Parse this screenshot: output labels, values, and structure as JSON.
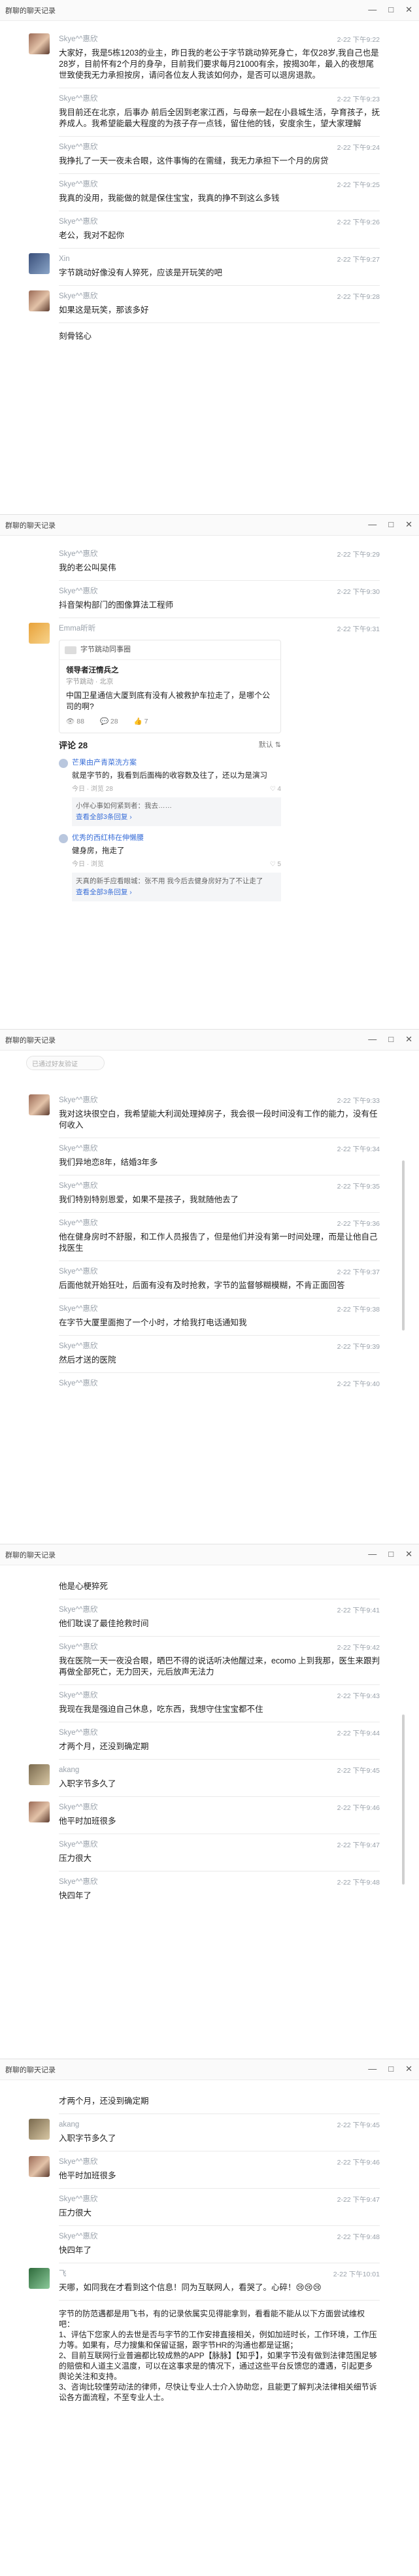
{
  "window": {
    "title": "群聊的聊天记录",
    "controls": [
      "—",
      "□",
      "✕"
    ]
  },
  "pages": [
    {
      "messages": [
        {
          "avatar": "girl",
          "name": "Skye^^惠欣",
          "time": "2-22 下午9:22",
          "text": "大家好，我是5栋1203的业主，昨日我的老公于字节跳动猝死身亡，年仅28岁,我自己也是28岁，目前怀有2个月的身孕，目前我们要求每月21000有余，按揭30年，最入的夜想尾世致使我无力承担按房，请问各位友人我该如何办，是否可以退房退款。"
        },
        {
          "avatar": "girl",
          "name": "Skye^^惠欣",
          "time": "2-22 下午9:23",
          "text": "我目前还在北京，后事办 前后全因到老家江西，与母亲一起在小县城生活，孕育孩子，抚养成人。我希望能最大程度的为孩子存一点钱，留住他的钱，安度余生，望大家理解"
        },
        {
          "avatar": "girl",
          "name": "Skye^^惠欣",
          "time": "2-22 下午9:24",
          "text": "我挣扎了一天一夜未合眼，这件事悔的在需缝，我无力承担下一个月的房贷"
        },
        {
          "avatar": "girl",
          "name": "Skye^^惠欣",
          "time": "2-22 下午9:25",
          "text": "我真的没用，我能做的就是保住宝宝，我真的挣不到这么多钱"
        },
        {
          "avatar": "girl",
          "name": "Skye^^惠欣",
          "time": "2-22 下午9:26",
          "text": "老公，我对不起你"
        },
        {
          "avatar": "xin",
          "name": "Xin",
          "time": "2-22 下午9:27",
          "text": "字节跳动好像没有人猝死，应该是开玩笑的吧"
        },
        {
          "avatar": "girl",
          "name": "Skye^^惠欣",
          "time": "2-22 下午9:28",
          "text": "如果这是玩笑，那该多好"
        },
        {
          "avatar": "girl",
          "name": "",
          "time": "",
          "text": "刻骨铭心"
        }
      ]
    },
    {
      "messages": [
        {
          "avatar": "girl",
          "name": "Skye^^惠欣",
          "time": "2-22 下午9:29",
          "text": "我的老公叫吴伟"
        },
        {
          "avatar": "girl",
          "name": "Skye^^惠欣",
          "time": "2-22 下午9:30",
          "text": "抖音架构部门的图像算法工程师"
        }
      ],
      "forward": {
        "name": "Emma昕昕",
        "time": "2-22 下午9:31",
        "card_head": "字节跳动同事圈",
        "post_author": "领导者汪情兵之",
        "post_sub": "字节跳动 · 北京",
        "post_text": "中国卫星通信大厦到底有没有人被救护车拉走了，是哪个公司的啊?",
        "post_stats": [
          "👁 88",
          "💬 28",
          "👍 7"
        ],
        "comments_title": "评论 28",
        "comments_sort": "默认 ⇅",
        "comments": [
          {
            "who": "芒果由产青菜洗方案",
            "body": "就是字节的，我看到后面梅的收容数及往了，还以为是演习",
            "meta_left": "今日 · 浏览 28",
            "meta_right": "♡ 4",
            "quote": "小伴心事如何紧到者：我去……",
            "quote_more": "查看全部3条回复 ›"
          },
          {
            "who": "优秀的西红柿在伸懒腰",
            "body": "健身房，拖走了",
            "meta_left": "今日 · 浏览",
            "meta_right": "♡ 5",
            "quote": "天真的新手应看眼城：张不用 我今后去健身房好为了不让走了",
            "quote_more": "查看全部3条回复 ›"
          }
        ]
      }
    },
    {
      "hint": "已通过好友验证",
      "messages": [
        {
          "avatar": "girl",
          "name": "Skye^^惠欣",
          "time": "2-22 下午9:33",
          "text": "我对这块很空白，我希望能大利润处理掉房子，我会很一段时间没有工作的能力，没有任何收入"
        },
        {
          "avatar": "girl",
          "name": "Skye^^惠欣",
          "time": "2-22 下午9:34",
          "text": "我们异地恋8年，结婚3年多"
        },
        {
          "avatar": "girl",
          "name": "Skye^^惠欣",
          "time": "2-22 下午9:35",
          "text": "我们特别特别恩爱，如果不是孩子，我就随他去了"
        },
        {
          "avatar": "girl",
          "name": "Skye^^惠欣",
          "time": "2-22 下午9:36",
          "text": "他在健身房时不舒服，和工作人员报告了，但是他们并没有第一时间处理，而是让他自己找医生"
        },
        {
          "avatar": "girl",
          "name": "Skye^^惠欣",
          "time": "2-22 下午9:37",
          "text": "后面他就开始狂吐，后面有没有及时抢救，字节的监督够糊模糊，不肯正面回答"
        },
        {
          "avatar": "girl",
          "name": "Skye^^惠欣",
          "time": "2-22 下午9:38",
          "text": "在字节大厦里面抱了一个小时，才给我打电话通知我"
        },
        {
          "avatar": "girl",
          "name": "Skye^^惠欣",
          "time": "2-22 下午9:39",
          "text": "然后才送的医院"
        },
        {
          "avatar": "girl",
          "name": "Skye^^惠欣",
          "time": "2-22 下午9:40",
          "text": ""
        }
      ]
    },
    {
      "messages": [
        {
          "avatar": "girl",
          "name": "",
          "time": "",
          "text": "他是心梗猝死"
        },
        {
          "avatar": "girl",
          "name": "Skye^^惠欣",
          "time": "2-22 下午9:41",
          "text": "他们耽误了最佳抢救时间"
        },
        {
          "avatar": "girl",
          "name": "Skye^^惠欣",
          "time": "2-22 下午9:42",
          "text": "我在医院一天一夜没合眼，晒巴不得的说话听决他醒过来，ecomo 上到我那，医生来跟判再做全部死亡，无力回天，元后放声无法力"
        },
        {
          "avatar": "girl",
          "name": "Skye^^惠欣",
          "time": "2-22 下午9:43",
          "text": "我现在我是强迫自己休息，吃东西，我想守住宝宝都不住"
        },
        {
          "avatar": "girl",
          "name": "Skye^^惠欣",
          "time": "2-22 下午9:44",
          "text": "才两个月，还没到确定期"
        },
        {
          "avatar": "akang",
          "name": "akang",
          "time": "2-22 下午9:45",
          "text": "入职字节多久了"
        },
        {
          "avatar": "girl",
          "name": "Skye^^惠欣",
          "time": "2-22 下午9:46",
          "text": "他平时加班很多"
        },
        {
          "avatar": "girl",
          "name": "Skye^^惠欣",
          "time": "2-22 下午9:47",
          "text": "压力很大"
        },
        {
          "avatar": "girl",
          "name": "Skye^^惠欣",
          "time": "2-22 下午9:48",
          "text": "快四年了"
        }
      ]
    },
    {
      "messages": [
        {
          "avatar": "girl",
          "name": "",
          "time": "",
          "text": "才两个月，还没到确定期"
        },
        {
          "avatar": "akang",
          "name": "akang",
          "time": "2-22 下午9:45",
          "text": "入职字节多久了"
        },
        {
          "avatar": "girl",
          "name": "Skye^^惠欣",
          "time": "2-22 下午9:46",
          "text": "他平时加班很多"
        },
        {
          "avatar": "girl",
          "name": "Skye^^惠欣",
          "time": "2-22 下午9:47",
          "text": "压力很大"
        },
        {
          "avatar": "girl",
          "name": "Skye^^惠欣",
          "time": "2-22 下午9:48",
          "text": "快四年了"
        },
        {
          "avatar": "ye",
          "name": "飞",
          "time": "2-22 下午10:01",
          "text": "天哪，如同我在才看到这个信息！同为互联网人，看哭了。心碎！😢😢😢"
        },
        {
          "avatar": "",
          "name": "",
          "time": "",
          "text": "字节的防范遇都是用飞书，有的记录依属实见得能拿到，看看能不能从以下方面尝试维权吧：\n1、评估下您家人的去世是否与字节的工作安排直接相关，例如加班时长，工作环境，工作压力等。如果有，尽力搜集和保留证据，跟字节HR的沟通也都是证据；\n2、目前互联网行业普遍都比较成熟的APP【脉脉】【知乎】，如果字节没有做到法律范围足够的赔偿和人道主义温度，可以在这事求是的情况下，通过这些平台反馈您的遭遇，引起更多舆论关注和支持。\n3、咨询比较懂劳动法的律师，尽快让专业人士介入协助您，且能更了解判决法律相关细节诉讼各方面流程，不至专业人士。"
        }
      ]
    }
  ]
}
